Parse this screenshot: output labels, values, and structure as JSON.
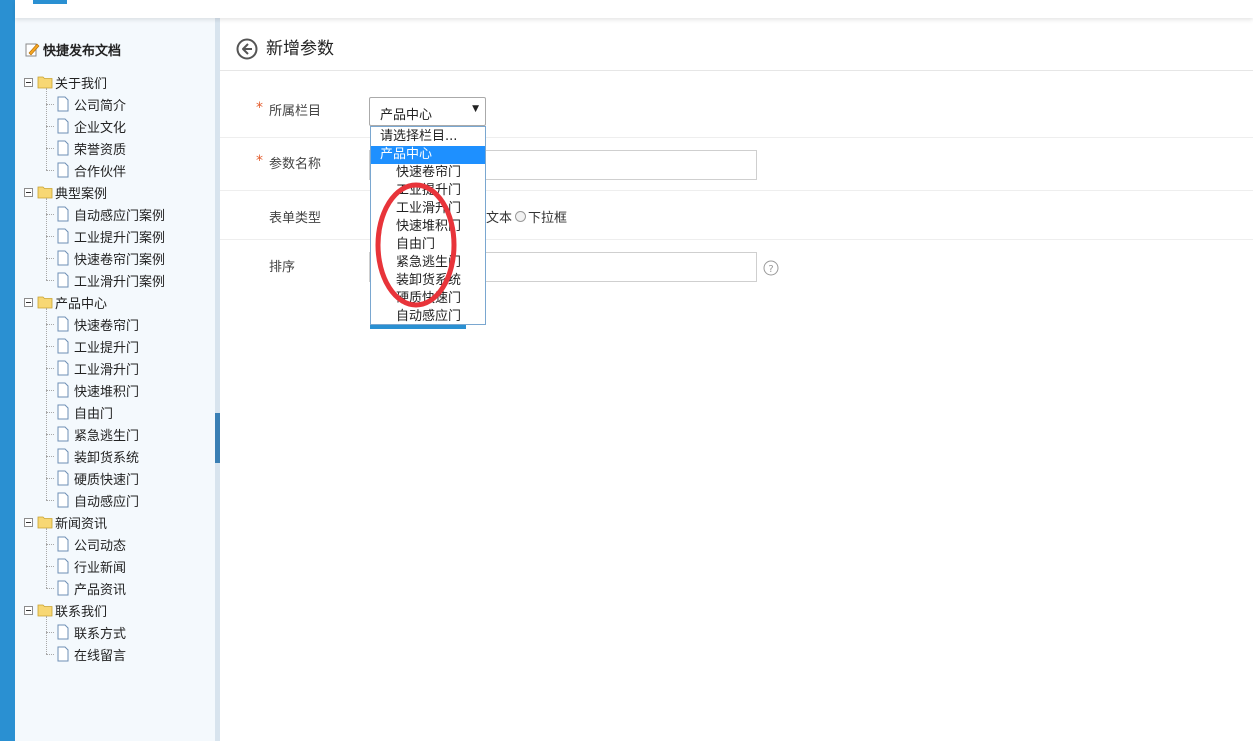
{
  "sidebar": {
    "title": "快捷发布文档",
    "tree": [
      {
        "label": "关于我们",
        "children": [
          "公司简介",
          "企业文化",
          "荣誉资质",
          "合作伙伴"
        ]
      },
      {
        "label": "典型案例",
        "children": [
          "自动感应门案例",
          "工业提升门案例",
          "快速卷帘门案例",
          "工业滑升门案例"
        ]
      },
      {
        "label": "产品中心",
        "children": [
          "快速卷帘门",
          "工业提升门",
          "工业滑升门",
          "快速堆积门",
          "自由门",
          "紧急逃生门",
          "装卸货系统",
          "硬质快速门",
          "自动感应门"
        ]
      },
      {
        "label": "新闻资讯",
        "children": [
          "公司动态",
          "行业新闻",
          "产品资讯"
        ]
      },
      {
        "label": "联系我们",
        "children": [
          "联系方式",
          "在线留言"
        ]
      }
    ]
  },
  "page": {
    "title": "新增参数"
  },
  "form": {
    "required_mark": "*",
    "column_label": "所属栏目",
    "column_selected": "产品中心",
    "column_options": [
      "请选择栏目...",
      "产品中心",
      "快速卷帘门",
      "工业提升门",
      "工业滑升门",
      "快速堆积门",
      "自由门",
      "紧急逃生门",
      "装卸货系统",
      "硬质快速门",
      "自动感应门"
    ],
    "column_selected_index": 1,
    "name_label": "参数名称",
    "type_label": "表单类型",
    "type_option_text": "文本",
    "type_option_dropdown": "下拉框",
    "sort_label": "排序"
  },
  "colors": {
    "accent": "#2a90d2",
    "selected": "#1e90ff",
    "required": "#e35b2b",
    "annotation": "#e8343a"
  }
}
